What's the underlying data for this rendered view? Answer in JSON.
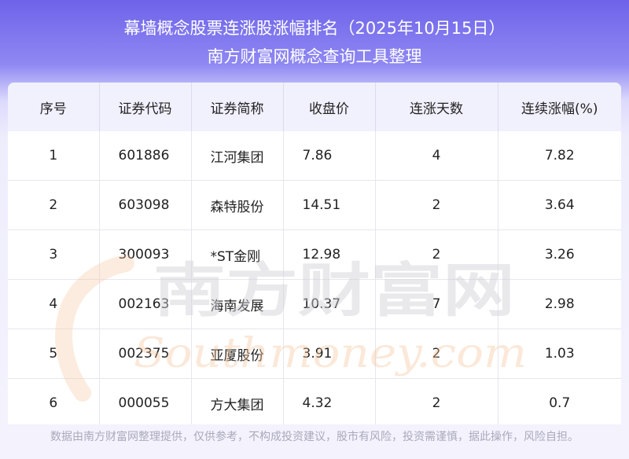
{
  "header": {
    "title": "幕墙概念股票连涨股涨幅排名（2025年10月15日）",
    "subtitle": "南方财富网概念查询工具整理"
  },
  "table": {
    "columns": [
      "序号",
      "证券代码",
      "证券简称",
      "收盘价",
      "连涨天数",
      "连续涨幅(%)"
    ],
    "rows": [
      [
        "1",
        "601886",
        "江河集团",
        "7.86",
        "4",
        "7.82"
      ],
      [
        "2",
        "603098",
        "森特股份",
        "14.51",
        "2",
        "3.64"
      ],
      [
        "3",
        "300093",
        "*ST金刚",
        "12.98",
        "2",
        "3.26"
      ],
      [
        "4",
        "002163",
        "海南发展",
        "10.37",
        "7",
        "2.98"
      ],
      [
        "5",
        "002375",
        "亚厦股份",
        "3.91",
        "2",
        "1.03"
      ],
      [
        "6",
        "000055",
        "方大集团",
        "4.32",
        "2",
        "0.7"
      ]
    ]
  },
  "watermark": {
    "cn": "南方财富网",
    "en": "Southmoney.com"
  },
  "footer": {
    "disclaimer": "数据由南方财富网整理提供，仅供参考，不构成投资建议，股市有风险，投资需谨慎，据此操作，风险自担。"
  },
  "colors": {
    "header_gradient_top": "#6e63ea",
    "header_row_bg": "#f1f0fd",
    "watermark_orange": "#f5c49a",
    "watermark_gray": "#cfcfd6"
  }
}
